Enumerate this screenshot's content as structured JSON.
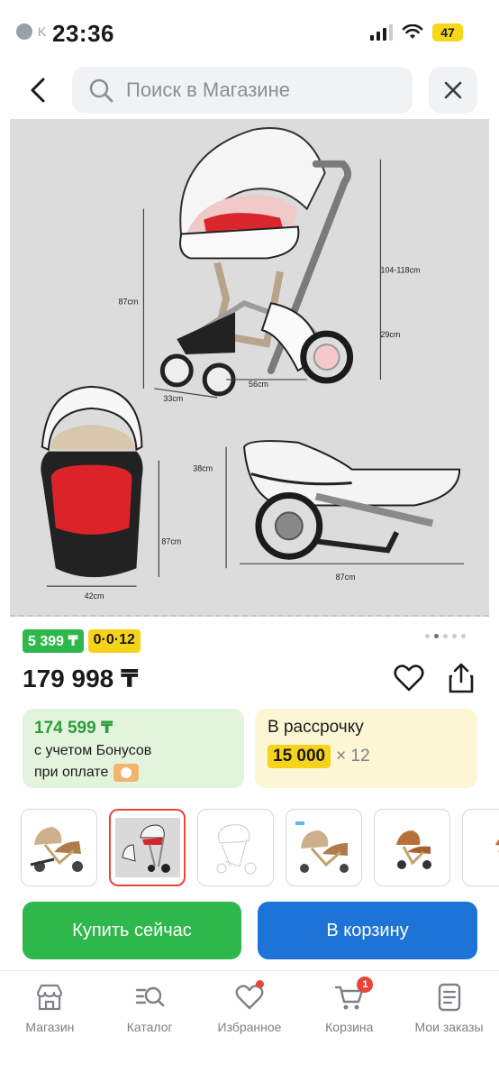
{
  "status_bar": {
    "time": "23:36",
    "app_back_label": "K",
    "battery": "47"
  },
  "search": {
    "placeholder": "Поиск в Магазине"
  },
  "product_image": {
    "dimension_labels": [
      "87cm",
      "104-118cm",
      "29cm",
      "33cm",
      "56cm",
      "87cm",
      "42cm",
      "38cm",
      "87cm"
    ]
  },
  "badges": {
    "green": "5 399 ₸",
    "yellow": "0·0·12"
  },
  "pager": {
    "total": 5,
    "active": 1
  },
  "price": "179 998 ₸",
  "bonus_card": {
    "amount": "174 599 ₸",
    "line1": "с учетом Бонусов",
    "line2": "при оплате"
  },
  "credit_card": {
    "title": "В рассрочку",
    "monthly": "15 000",
    "term": "× 12"
  },
  "thumbnails": [
    {
      "icon": "stroller-gold-thumb-icon",
      "active": false
    },
    {
      "icon": "stroller-white-thumb-icon",
      "active": true
    },
    {
      "icon": "stroller-sketch-thumb-icon",
      "active": false
    },
    {
      "icon": "stroller-gold-thumb-icon",
      "active": false
    },
    {
      "icon": "stroller-brown-thumb-icon",
      "active": false
    },
    {
      "icon": "stroller-partial-thumb-icon",
      "active": false
    }
  ],
  "buttons": {
    "buy_now": "Купить сейчас",
    "add_to_cart": "В корзину"
  },
  "bottom_nav": {
    "items": [
      {
        "label": "Магазин",
        "icon": "store-icon"
      },
      {
        "label": "Каталог",
        "icon": "catalog-search-icon"
      },
      {
        "label": "Избранное",
        "icon": "heart-icon",
        "dot": true
      },
      {
        "label": "Корзина",
        "icon": "cart-icon",
        "count": "1"
      },
      {
        "label": "Мои заказы",
        "icon": "orders-icon"
      }
    ]
  },
  "colors": {
    "green": "#2eb84b",
    "blue": "#1e73d6",
    "yellow": "#f6d31b",
    "red": "#e8443a"
  }
}
